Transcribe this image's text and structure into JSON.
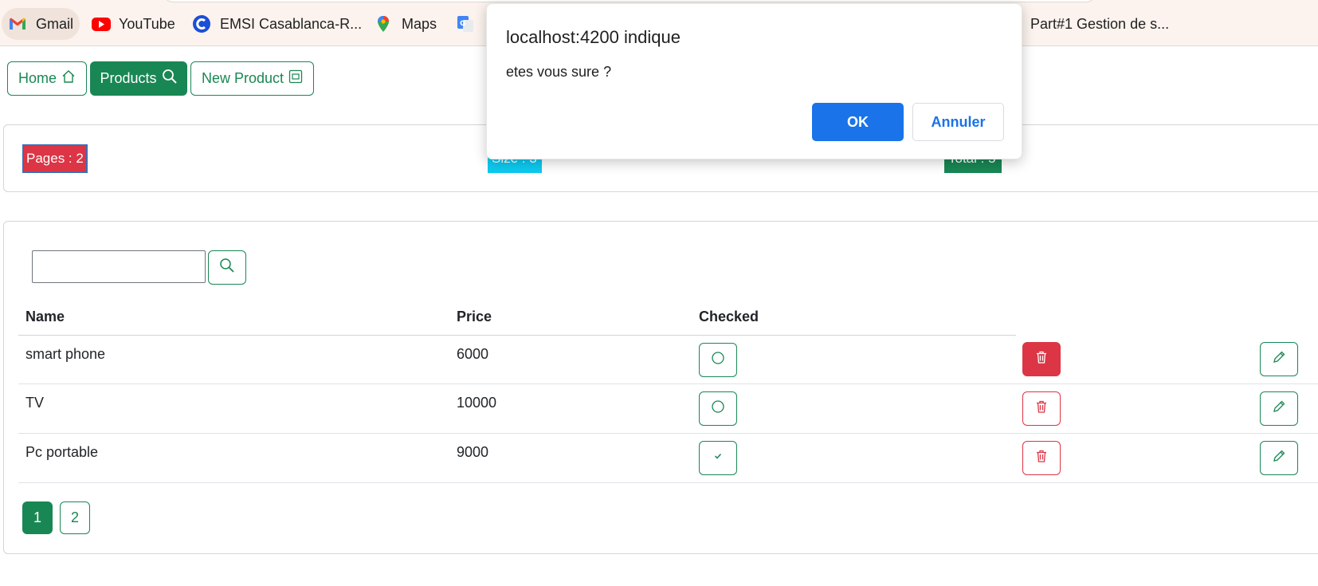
{
  "bookmarks": [
    {
      "label": "Gmail",
      "icon": "gmail-icon"
    },
    {
      "label": "YouTube",
      "icon": "youtube-icon"
    },
    {
      "label": "EMSI Casablanca-R...",
      "icon": "emsi-icon"
    },
    {
      "label": "Maps",
      "icon": "maps-icon"
    },
    {
      "label": "",
      "icon": "translate-icon"
    },
    {
      "label": "Part#1 Gestion de s...",
      "icon": ""
    }
  ],
  "nav": {
    "home": "Home",
    "products": "Products",
    "new_product": "New Product"
  },
  "stats": {
    "pages": "Pages : 2",
    "size": "Size : 3",
    "total": "Total : 5"
  },
  "table": {
    "headers": [
      "Name",
      "Price",
      "Checked"
    ],
    "rows": [
      {
        "name": "smart phone",
        "price": "6000",
        "checked": false
      },
      {
        "name": "TV",
        "price": "10000",
        "checked": false
      },
      {
        "name": "Pc portable",
        "price": "9000",
        "checked": true
      }
    ]
  },
  "pagination": [
    "1",
    "2"
  ],
  "dialog": {
    "title": "localhost:4200 indique",
    "message": "etes vous sure ?",
    "ok": "OK",
    "cancel": "Annuler"
  },
  "colors": {
    "success": "#198754",
    "danger": "#dc3545",
    "info": "#0dcaf0",
    "dialog_primary": "#1a73e8"
  }
}
